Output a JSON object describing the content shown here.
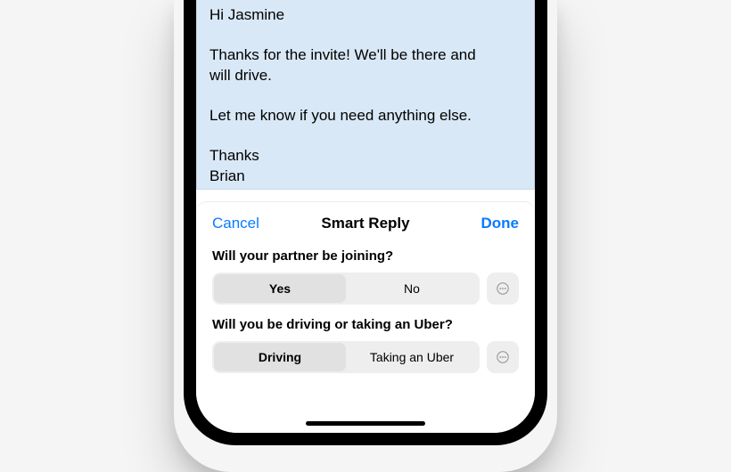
{
  "email": {
    "greeting": "Hi Jasmine",
    "para1a": "Thanks for the invite! We'll be there and",
    "para1b": "will drive.",
    "para2": "Let me know if you need anything else.",
    "signoff": "Thanks",
    "sender": "Brian"
  },
  "sheet": {
    "cancel_label": "Cancel",
    "title": "Smart Reply",
    "done_label": "Done"
  },
  "questions": [
    {
      "label": "Will your partner be joining?",
      "options": [
        "Yes",
        "No"
      ],
      "selected": "Yes"
    },
    {
      "label": "Will you be driving or taking an Uber?",
      "options": [
        "Driving",
        "Taking an Uber"
      ],
      "selected": "Driving"
    }
  ],
  "colors": {
    "accent": "#0a7aff",
    "selection_bg": "#d9e8f6"
  }
}
